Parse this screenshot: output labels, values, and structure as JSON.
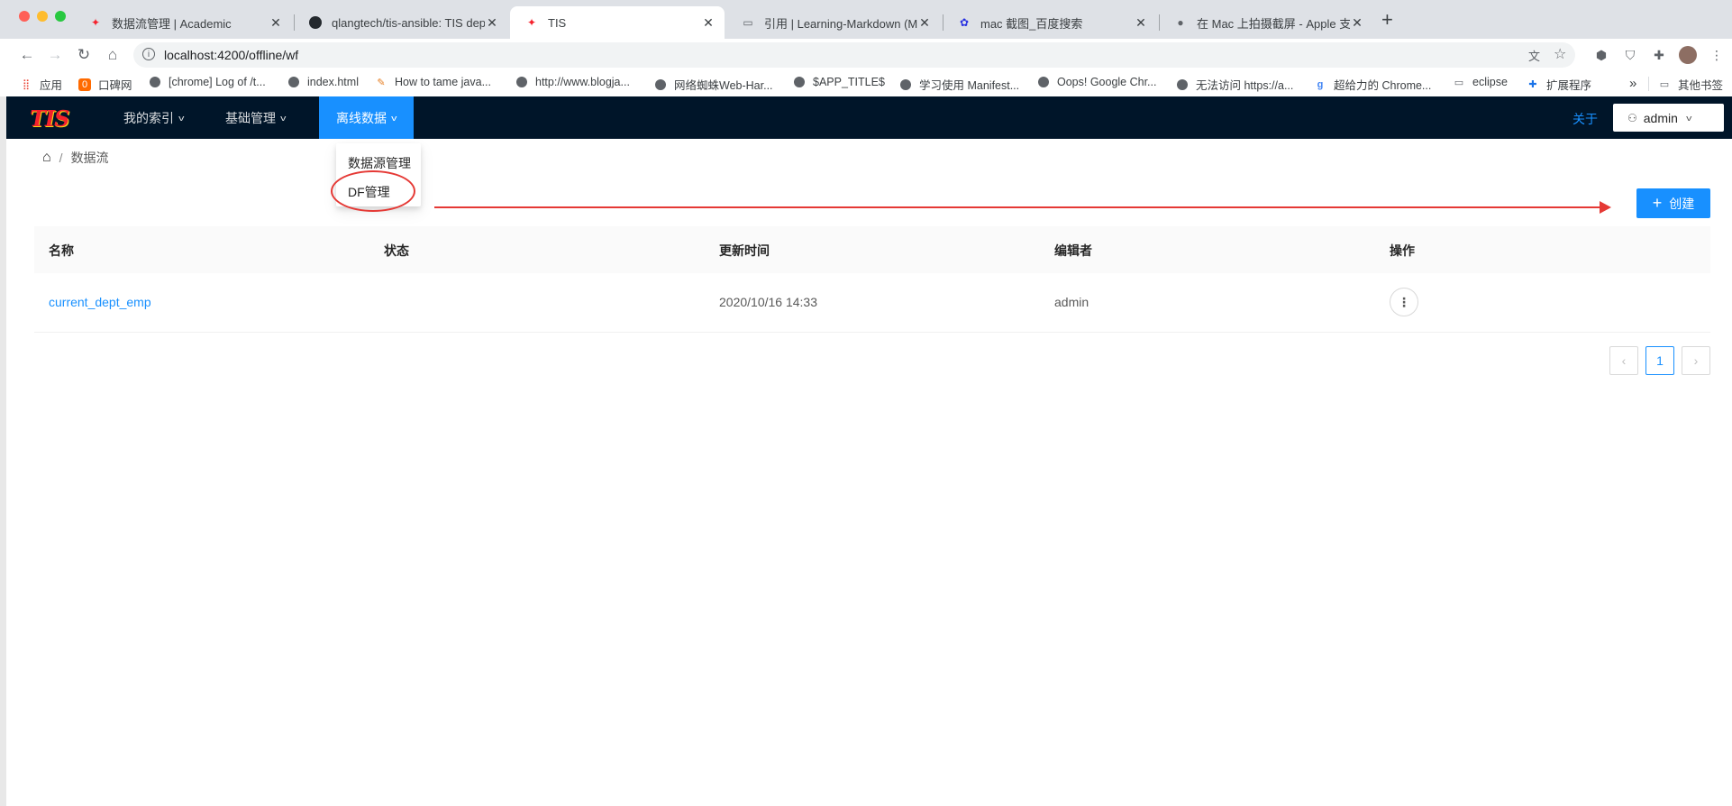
{
  "browser": {
    "tabs": [
      {
        "title": "数据流管理 | Academic",
        "icon": "tis-logo-icon",
        "active": false
      },
      {
        "title": "qlangtech/tis-ansible: TIS depl",
        "icon": "github-icon",
        "active": false
      },
      {
        "title": "TIS",
        "icon": "tis-logo-icon",
        "active": true
      },
      {
        "title": "引用 | Learning-Markdown (Ma",
        "icon": "book-icon",
        "active": false
      },
      {
        "title": "mac 截图_百度搜索",
        "icon": "baidu-icon",
        "active": false
      },
      {
        "title": "在 Mac 上拍摄截屏 - Apple 支持",
        "icon": "apple-icon",
        "active": false
      }
    ],
    "new_tab": "+",
    "close_glyph": "✕",
    "url": "localhost:4200/offline/wf",
    "bookmarks": [
      {
        "label": "应用",
        "icon": "apps-grid-icon"
      },
      {
        "label": "口碑网",
        "icon": "koubei-icon"
      },
      {
        "label": "[chrome] Log of /t...",
        "icon": "globe-icon"
      },
      {
        "label": "index.html",
        "icon": "globe-icon"
      },
      {
        "label": "How to tame java...",
        "icon": "feather-icon"
      },
      {
        "label": "http://www.blogja...",
        "icon": "globe-icon"
      },
      {
        "label": "网络蜘蛛Web-Har...",
        "icon": "globe-icon"
      },
      {
        "label": "$APP_TITLE$",
        "icon": "globe-icon"
      },
      {
        "label": "学习使用 Manifest...",
        "icon": "globe-icon"
      },
      {
        "label": "Oops! Google Chr...",
        "icon": "globe-icon"
      },
      {
        "label": "无法访问 https://a...",
        "icon": "globe-icon"
      },
      {
        "label": "超给力的 Chrome...",
        "icon": "google-icon"
      },
      {
        "label": "eclipse",
        "icon": "folder-icon"
      },
      {
        "label": "扩展程序",
        "icon": "puzzle-icon"
      }
    ],
    "more_bookmarks": "»",
    "other_bookmarks": "其他书签"
  },
  "app": {
    "logo": "TIS",
    "menu": [
      {
        "label": "我的索引",
        "selected": false
      },
      {
        "label": "基础管理",
        "selected": false
      },
      {
        "label": "离线数据",
        "selected": true
      }
    ],
    "about": "关于",
    "user": "admin",
    "breadcrumb": {
      "separator": "/",
      "current": "数据流"
    },
    "dropdown": [
      "数据源管理",
      "DF管理"
    ],
    "create_button": "创建",
    "create_icon": "+",
    "table": {
      "columns": [
        "名称",
        "状态",
        "更新时间",
        "编辑者",
        "操作"
      ],
      "rows": [
        {
          "name": "current_dept_emp",
          "status": "",
          "updated": "2020/10/16 14:33",
          "editor": "admin"
        }
      ]
    },
    "pagination": {
      "prev": "‹",
      "current": "1",
      "next": "›"
    }
  },
  "colors": {
    "nav_bg": "#001529",
    "primary": "#1890ff",
    "annotation": "#e53935"
  }
}
